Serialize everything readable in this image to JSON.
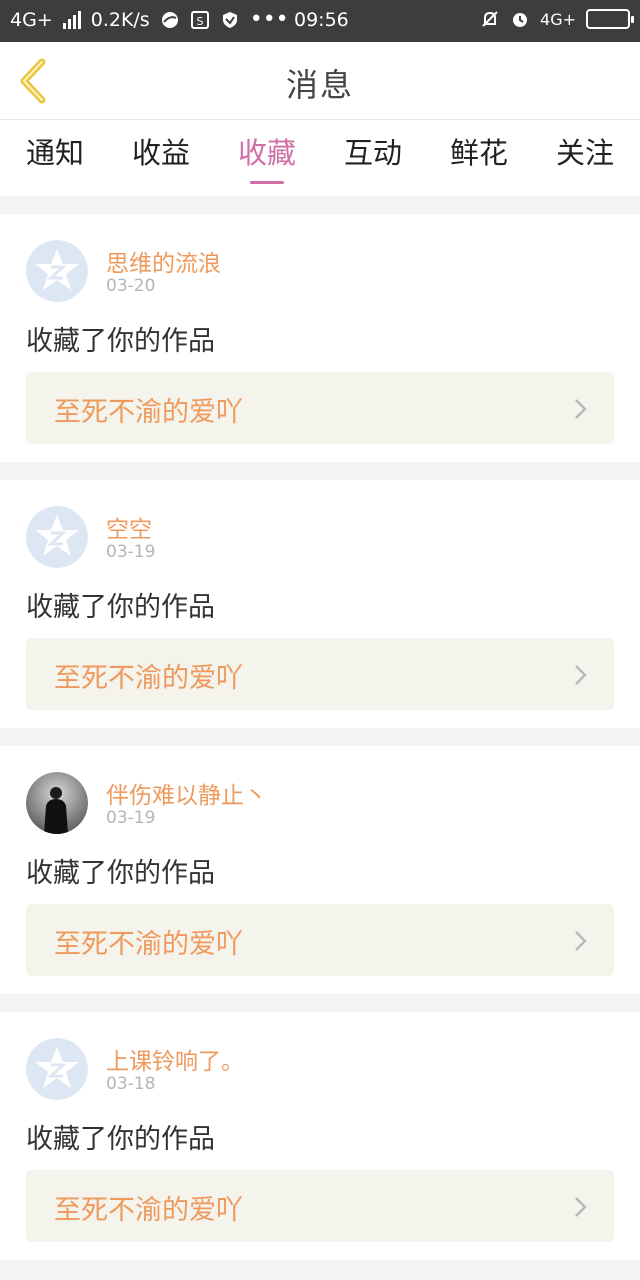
{
  "status_bar": {
    "network": "4G+",
    "speed": "0.2K/s",
    "time": "09:56",
    "network_right": "4G+"
  },
  "header": {
    "title": "消息"
  },
  "tabs": [
    {
      "label": "通知",
      "active": false
    },
    {
      "label": "收益",
      "active": false
    },
    {
      "label": "收藏",
      "active": true
    },
    {
      "label": "互动",
      "active": false
    },
    {
      "label": "鲜花",
      "active": false
    },
    {
      "label": "关注",
      "active": false
    }
  ],
  "messages": [
    {
      "user": "思维的流浪",
      "date": "03-20",
      "action": "收藏了你的作品",
      "work": "至死不渝的爱吖",
      "avatar": "default-avatar"
    },
    {
      "user": "空空",
      "date": "03-19",
      "action": "收藏了你的作品",
      "work": "至死不渝的爱吖",
      "avatar": "default-avatar"
    },
    {
      "user": "伴伤难以静止丶",
      "date": "03-19",
      "action": "收藏了你的作品",
      "work": "至死不渝的爱吖",
      "avatar": "photo-avatar"
    },
    {
      "user": "上课铃响了。",
      "date": "03-18",
      "action": "收藏了你的作品",
      "work": "至死不渝的爱吖",
      "avatar": "default-avatar"
    }
  ],
  "colors": {
    "accent_pink": "#d06fa5",
    "accent_orange": "#ef9a5d",
    "back_arrow": "#e8c53a"
  }
}
